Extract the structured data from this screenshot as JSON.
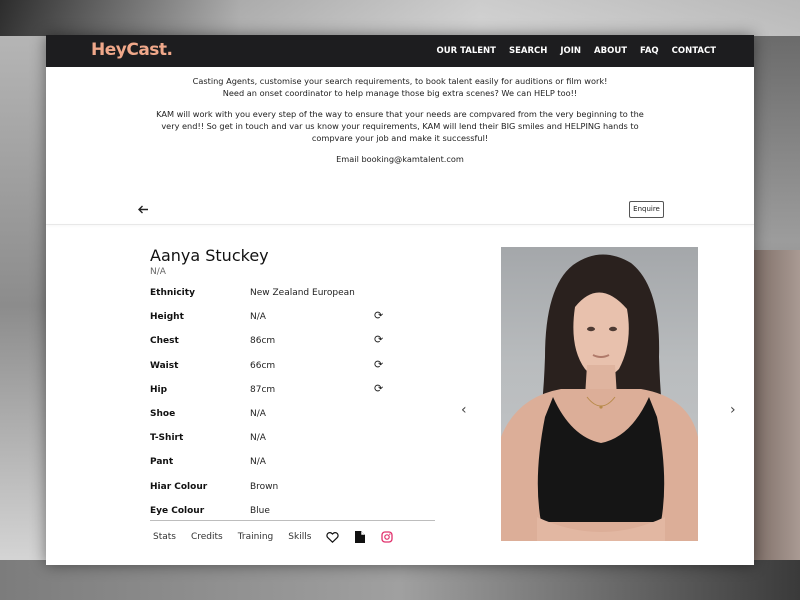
{
  "brand": {
    "logo": "HeyCast.",
    "logo_color": "#f0a88a",
    "nav_bg": "#1d1d1f"
  },
  "nav": [
    "OUR TALENT",
    "SEARCH",
    "JOIN",
    "ABOUT",
    "FAQ",
    "CONTACT"
  ],
  "intro": {
    "line1": "Casting Agents, customise your search requirements, to book talent easily for auditions or film work!",
    "line2": "Need an onset coordinator to help manage those big extra scenes? We can HELP too!!",
    "paragraph": "KAM will work with you every step of the way to ensure that your needs are compvared from the very beginning to the very end!! So get in touch and var us know your requirements, KAM will lend their BIG smiles and HELPING hands to compvare your job and make it successful!",
    "email": "Email booking@kamtalent.com"
  },
  "toolbar": {
    "back_icon": "arrow-left-icon",
    "enquire_label": "Enquire"
  },
  "profile": {
    "name": "Aanya Stuckey",
    "subtitle": "N/A",
    "stats": [
      {
        "label": "Ethnicity",
        "value": "New Zealand European",
        "icon": null
      },
      {
        "label": "Height",
        "value": "N/A",
        "icon": "refresh-icon"
      },
      {
        "label": "Chest",
        "value": "86cm",
        "icon": "refresh-icon"
      },
      {
        "label": "Waist",
        "value": "66cm",
        "icon": "refresh-icon"
      },
      {
        "label": "Hip",
        "value": "87cm",
        "icon": "refresh-icon"
      },
      {
        "label": "Shoe",
        "value": "N/A",
        "icon": null
      },
      {
        "label": "T-Shirt",
        "value": "N/A",
        "icon": null
      },
      {
        "label": "Pant",
        "value": "N/A",
        "icon": null
      },
      {
        "label": "Hiar Colour",
        "value": "Brown",
        "icon": null
      },
      {
        "label": "Eye Colour",
        "value": "Blue",
        "icon": null
      }
    ],
    "tabs": [
      "Stats",
      "Credits",
      "Training",
      "Skills"
    ],
    "tab_icons": [
      "heart-icon",
      "document-icon",
      "instagram-icon"
    ],
    "instagram_color": "#e1306c"
  },
  "carousel": {
    "prev_icon": "chevron-left-icon",
    "next_icon": "chevron-right-icon"
  }
}
